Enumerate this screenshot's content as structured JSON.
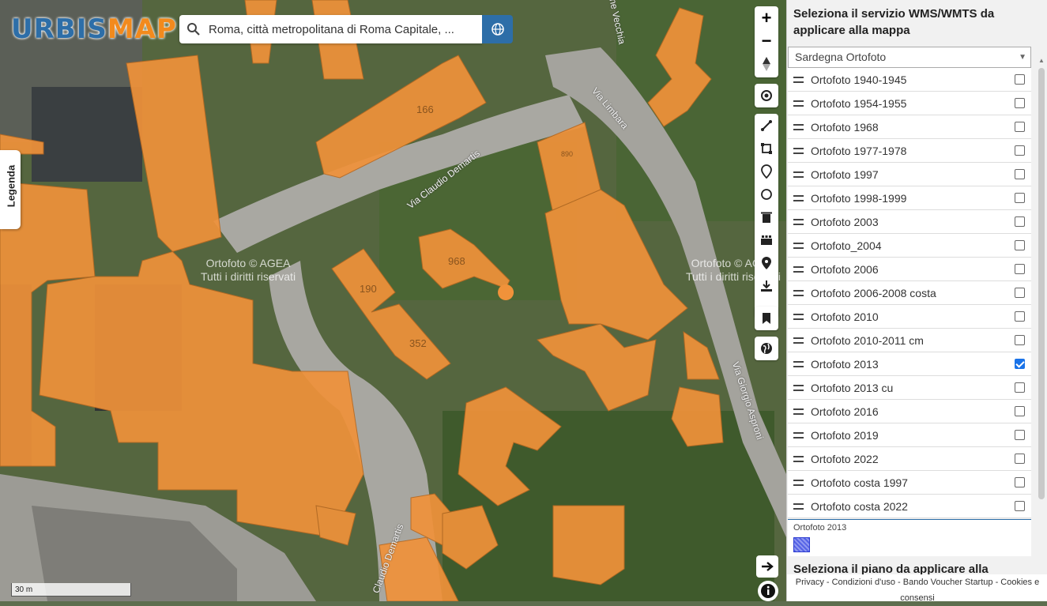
{
  "app": {
    "name": "URBISMAP",
    "name_part1": "URBIS",
    "name_part2": "MAP"
  },
  "search": {
    "value": "Roma, città metropolitana di Roma Capitale, ..."
  },
  "legend_tab": {
    "label": "Legenda"
  },
  "map": {
    "attribution_left": "Ortofoto © AGEA\nTutti i diritti riservati",
    "attribution_right": "Ortofoto © AGEA\nTutti i diritti riservati",
    "streets": [
      "Via Claudio Demartis",
      "Via Limbara",
      "Via Giorgio Asproni",
      "Claudio Demartis",
      "ne Vecchia"
    ],
    "building_numbers": [
      "166",
      "968",
      "190",
      "352",
      "890"
    ],
    "scale_label": "30 m"
  },
  "toolbar": {
    "zoom_in": "+",
    "zoom_out": "−",
    "icons": [
      "zoom-in-icon",
      "zoom-out-icon",
      "north-arrow-icon",
      "locate-icon",
      "measure-line-icon",
      "measure-area-icon",
      "marker-icon",
      "circle-icon",
      "trash-icon",
      "layers-icon",
      "pin-icon",
      "download-icon",
      "bookmark-icon",
      "globe-icon",
      "arrow-right-icon",
      "info-icon"
    ]
  },
  "panel": {
    "wms_title": "Seleziona il servizio WMS/WMTS da applicare alla mappa",
    "service_selected": "Sardegna Ortofoto",
    "layers": [
      {
        "label": "Ortofoto 1940-1945",
        "checked": false
      },
      {
        "label": "Ortofoto 1954-1955",
        "checked": false
      },
      {
        "label": "Ortofoto 1968",
        "checked": false
      },
      {
        "label": "Ortofoto 1977-1978",
        "checked": false
      },
      {
        "label": "Ortofoto 1997",
        "checked": false
      },
      {
        "label": "Ortofoto 1998-1999",
        "checked": false
      },
      {
        "label": "Ortofoto 2003",
        "checked": false
      },
      {
        "label": "Ortofoto_2004",
        "checked": false
      },
      {
        "label": "Ortofoto 2006",
        "checked": false
      },
      {
        "label": "Ortofoto 2006-2008 costa",
        "checked": false
      },
      {
        "label": "Ortofoto 2010",
        "checked": false
      },
      {
        "label": "Ortofoto 2010-2011 cm",
        "checked": false
      },
      {
        "label": "Ortofoto 2013",
        "checked": true
      },
      {
        "label": "Ortofoto 2013 cu",
        "checked": false
      },
      {
        "label": "Ortofoto 2016",
        "checked": false
      },
      {
        "label": "Ortofoto 2019",
        "checked": false
      },
      {
        "label": "Ortofoto 2022",
        "checked": false
      },
      {
        "label": "Ortofoto costa 1997",
        "checked": false
      },
      {
        "label": "Ortofoto costa 2022",
        "checked": false
      }
    ],
    "legend_label": "Ortofoto 2013",
    "plan_title": "Seleziona il piano da applicare alla",
    "footer": "Privacy - Condizioni d'uso - Bando Voucher Startup - Cookies e consensi"
  },
  "colors": {
    "brand_blue": "#2d6ea8",
    "brand_orange": "#f28a1d",
    "building_fill": "#f0923a",
    "checkbox_on": "#1a73e8"
  }
}
